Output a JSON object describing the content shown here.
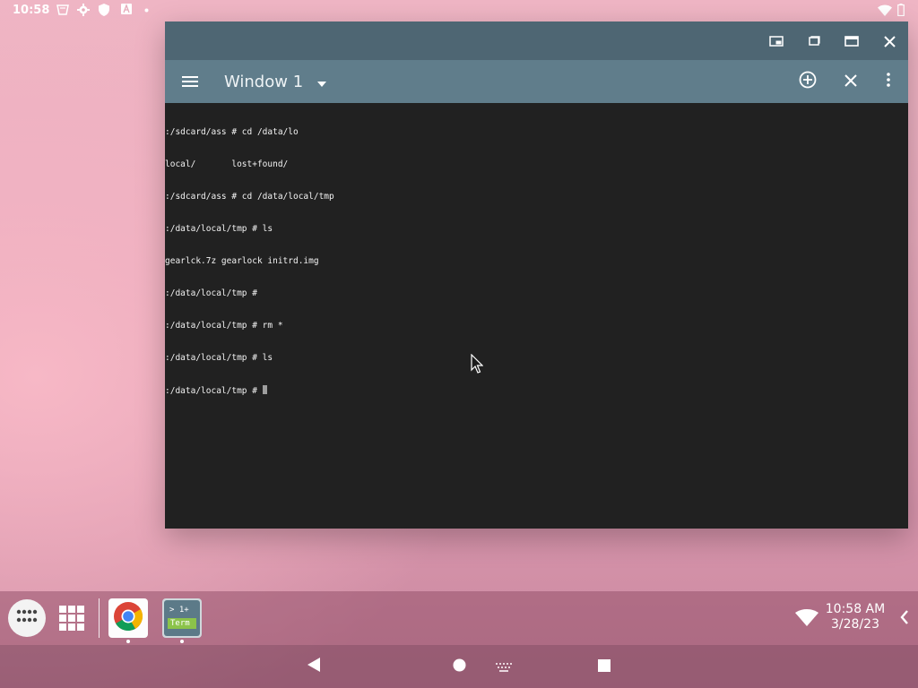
{
  "status_bar": {
    "time": "10:58",
    "icons": [
      "notification-icon",
      "gear-icon",
      "shield-icon",
      "app-a-icon",
      "small-dot-icon",
      "wifi-icon",
      "battery-icon"
    ]
  },
  "window": {
    "controls": [
      "picture-in-picture-icon",
      "restore-icon",
      "maximize-icon",
      "close-icon"
    ],
    "toolbar": {
      "menu_icon": "hamburger-menu-icon",
      "window_label": "Window 1",
      "actions": [
        "add-circle-icon",
        "close-icon",
        "more-vert-icon"
      ]
    },
    "terminal_lines": [
      ":/sdcard/ass # cd /data/lo",
      "local/       lost+found/",
      ":/sdcard/ass # cd /data/local/tmp",
      ":/data/local/tmp # ls",
      "gearlck.7z gearlock initrd.img",
      ":/data/local/tmp #",
      ":/data/local/tmp # rm *",
      ":/data/local/tmp # ls",
      ":/data/local/tmp # "
    ]
  },
  "taskbar": {
    "apps": [
      {
        "name": "Chrome",
        "icon": "chrome-icon"
      },
      {
        "name": "Terminal",
        "icon": "terminal-app-icon",
        "line1": "> 1+",
        "line2": "Term"
      }
    ],
    "clock_time": "10:58 AM",
    "clock_date": "3/28/23"
  },
  "colors": {
    "titlebar": "#4e6673",
    "toolbar": "#607d8b",
    "terminal_bg": "#212121",
    "terminal_fg": "#f2f2f2"
  }
}
